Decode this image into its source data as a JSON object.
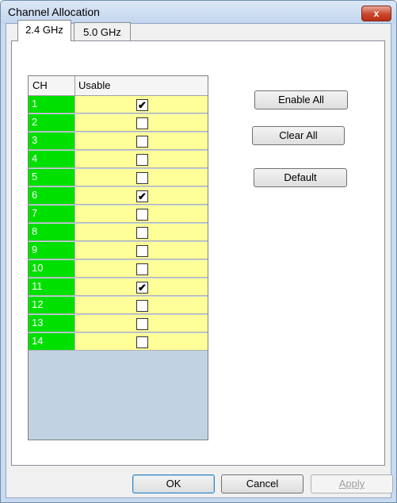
{
  "window": {
    "title": "Channel Allocation",
    "close_icon": "close-icon",
    "close_label": "x"
  },
  "tabs": [
    {
      "label": "2.4 GHz",
      "active": true
    },
    {
      "label": "5.0 GHz",
      "active": false
    }
  ],
  "grid": {
    "headers": {
      "ch": "CH",
      "usable": "Usable"
    },
    "colors": {
      "ch_bg": "#00e000",
      "usable_bg": "#ffff99"
    },
    "rows": [
      {
        "ch": "1",
        "checked": true
      },
      {
        "ch": "2",
        "checked": false
      },
      {
        "ch": "3",
        "checked": false
      },
      {
        "ch": "4",
        "checked": false
      },
      {
        "ch": "5",
        "checked": false
      },
      {
        "ch": "6",
        "checked": true
      },
      {
        "ch": "7",
        "checked": false
      },
      {
        "ch": "8",
        "checked": false
      },
      {
        "ch": "9",
        "checked": false
      },
      {
        "ch": "10",
        "checked": false
      },
      {
        "ch": "11",
        "checked": true
      },
      {
        "ch": "12",
        "checked": false
      },
      {
        "ch": "13",
        "checked": false
      },
      {
        "ch": "14",
        "checked": false
      }
    ]
  },
  "side_buttons": {
    "enable_all": "Enable All",
    "clear_all": "Clear All",
    "default": "Default"
  },
  "footer": {
    "ok": "OK",
    "cancel": "Cancel",
    "apply": "Apply",
    "apply_disabled": true
  }
}
